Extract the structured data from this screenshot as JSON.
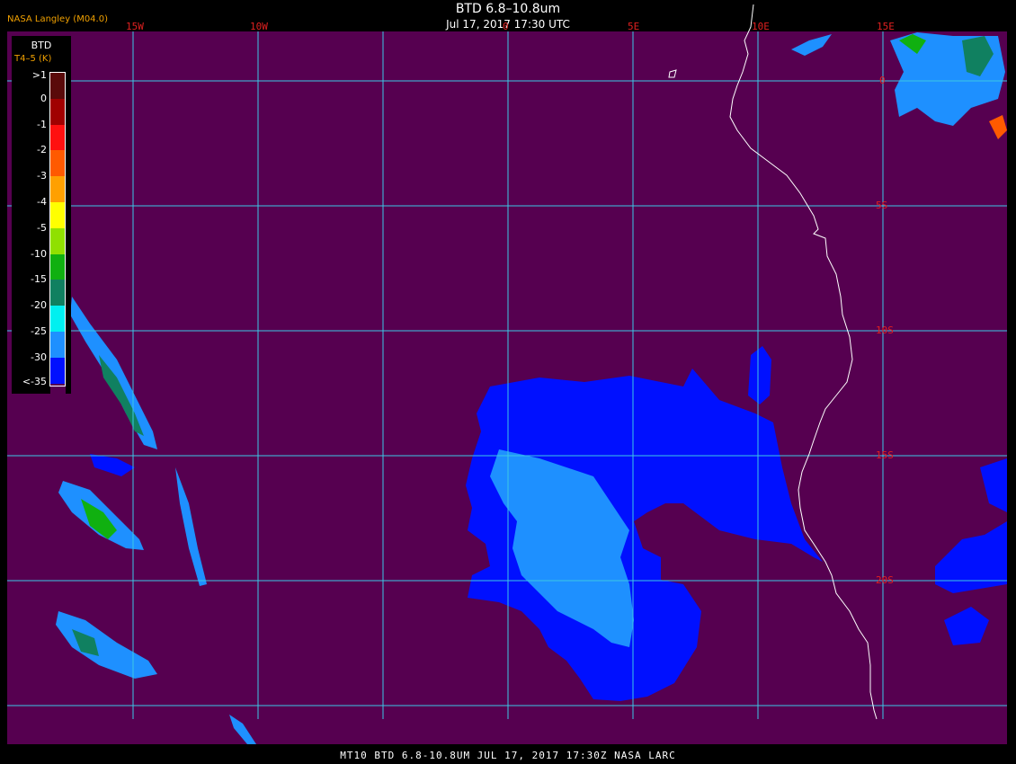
{
  "header": {
    "credit": "NASA Langley (M04.0)",
    "title": "BTD 6.8–10.8um",
    "subtitle": "Jul 17, 2017 17:30 UTC"
  },
  "footer": {
    "text": "MT10  BTD 6.8-10.8UM   JUL 17, 2017 17:30Z   NASA LARC"
  },
  "map": {
    "background_color": "#560050",
    "grid_color": "#3cc8e6",
    "coast_color": "#ffffff",
    "longitude_labels": [
      "15W",
      "10W",
      "0",
      "5E",
      "10E",
      "15E"
    ],
    "latitude_labels": [
      "0",
      "5S",
      "10S",
      "15S",
      "20S"
    ]
  },
  "legend": {
    "title": "BTD",
    "units": "T4–5 (K)",
    "labels": [
      ">1",
      "0",
      "-1",
      "-2",
      "-3",
      "-4",
      "-5",
      "-10",
      "-15",
      "-20",
      "-25",
      "-30",
      "<-35"
    ],
    "colors": [
      "#5a0a0a",
      "#a00000",
      "#ff1010",
      "#ff5a00",
      "#ffa000",
      "#ffff00",
      "#90e000",
      "#10b010",
      "#108060",
      "#00f0f0",
      "#1e90ff",
      "#0010ff",
      "#560050"
    ]
  }
}
